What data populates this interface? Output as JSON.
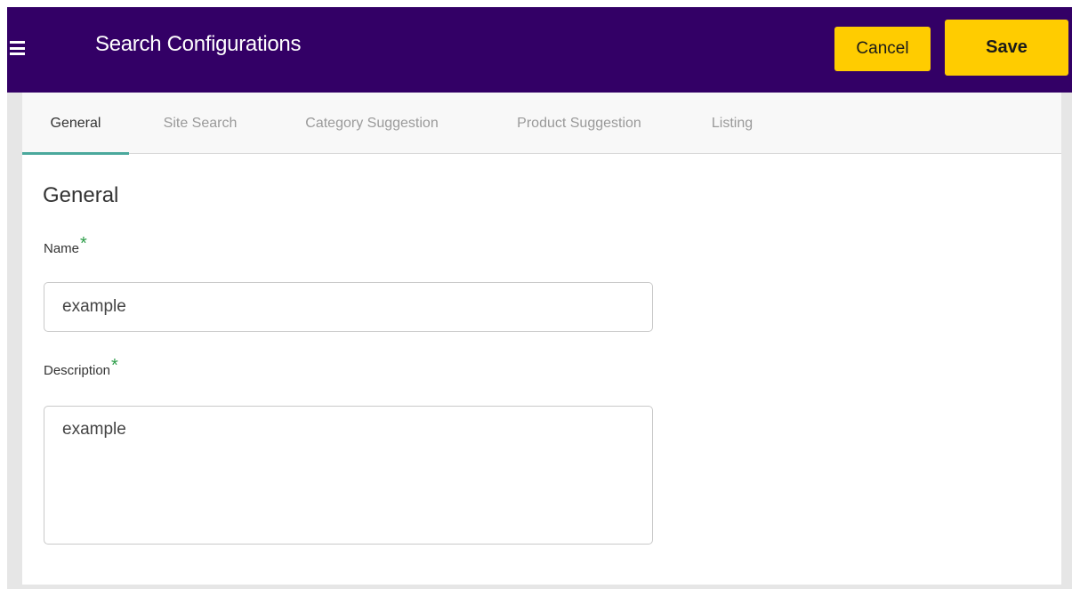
{
  "header": {
    "title": "Search Configurations",
    "cancel_label": "Cancel",
    "save_label": "Save"
  },
  "tabs": [
    {
      "label": "General",
      "active": true
    },
    {
      "label": "Site Search",
      "active": false
    },
    {
      "label": "Category Suggestion",
      "active": false
    },
    {
      "label": "Product Suggestion",
      "active": false
    },
    {
      "label": "Listing",
      "active": false
    }
  ],
  "section": {
    "title": "General"
  },
  "form": {
    "name_label": "Name",
    "name_value": "example",
    "description_label": "Description",
    "description_value": "example",
    "required_marker": "*"
  },
  "colors": {
    "header_bg": "#330066",
    "button_bg": "#ffcc00",
    "tab_indicator": "#4aa89c",
    "required_marker": "#2e9e4a"
  },
  "icons": {
    "menu": "hamburger-menu-icon"
  }
}
